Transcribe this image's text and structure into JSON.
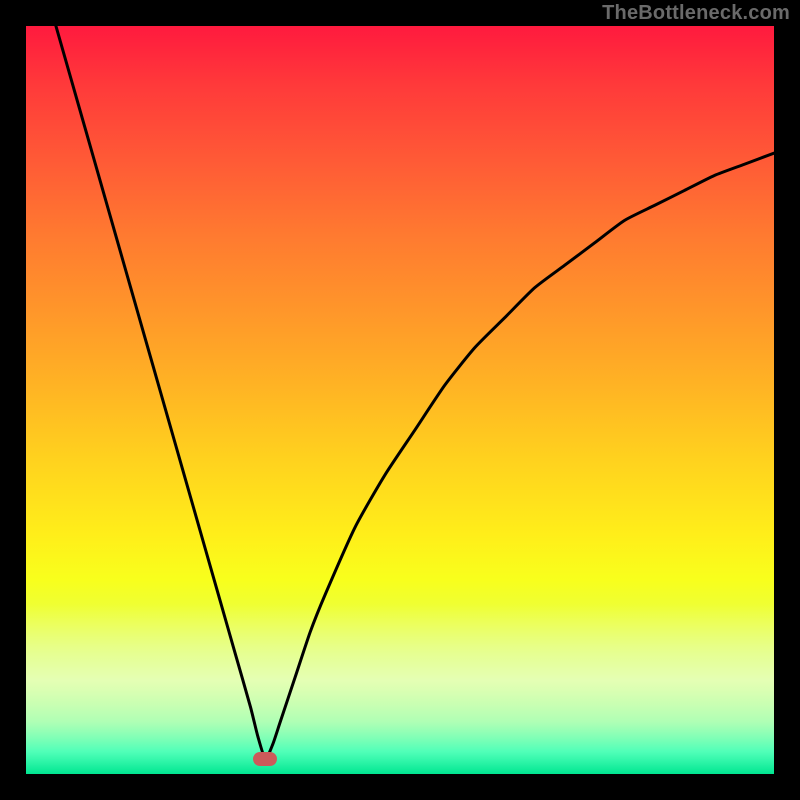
{
  "watermark": "TheBottleneck.com",
  "colors": {
    "marker": "#cc5a5a",
    "curve": "#000000"
  },
  "chart_data": {
    "type": "line",
    "title": "",
    "xlabel": "",
    "ylabel": "",
    "xlim": [
      0,
      100
    ],
    "ylim": [
      0,
      100
    ],
    "grid": false,
    "legend": false,
    "marker": {
      "x": 32,
      "y": 2
    },
    "series": [
      {
        "name": "bottleneck-curve",
        "x": [
          4,
          6,
          8,
          10,
          12,
          14,
          16,
          18,
          20,
          22,
          24,
          26,
          28,
          30,
          31,
          32,
          33,
          34,
          36,
          38,
          40,
          44,
          48,
          52,
          56,
          60,
          64,
          68,
          72,
          76,
          80,
          84,
          88,
          92,
          96,
          100
        ],
        "y": [
          100,
          93,
          86,
          79,
          72,
          65,
          58,
          51,
          44,
          37,
          30,
          23,
          16,
          9,
          5,
          2,
          4,
          7,
          13,
          19,
          24,
          33,
          40,
          46,
          52,
          57,
          61,
          65,
          68,
          71,
          74,
          76,
          78,
          80,
          81.5,
          83
        ]
      }
    ]
  }
}
